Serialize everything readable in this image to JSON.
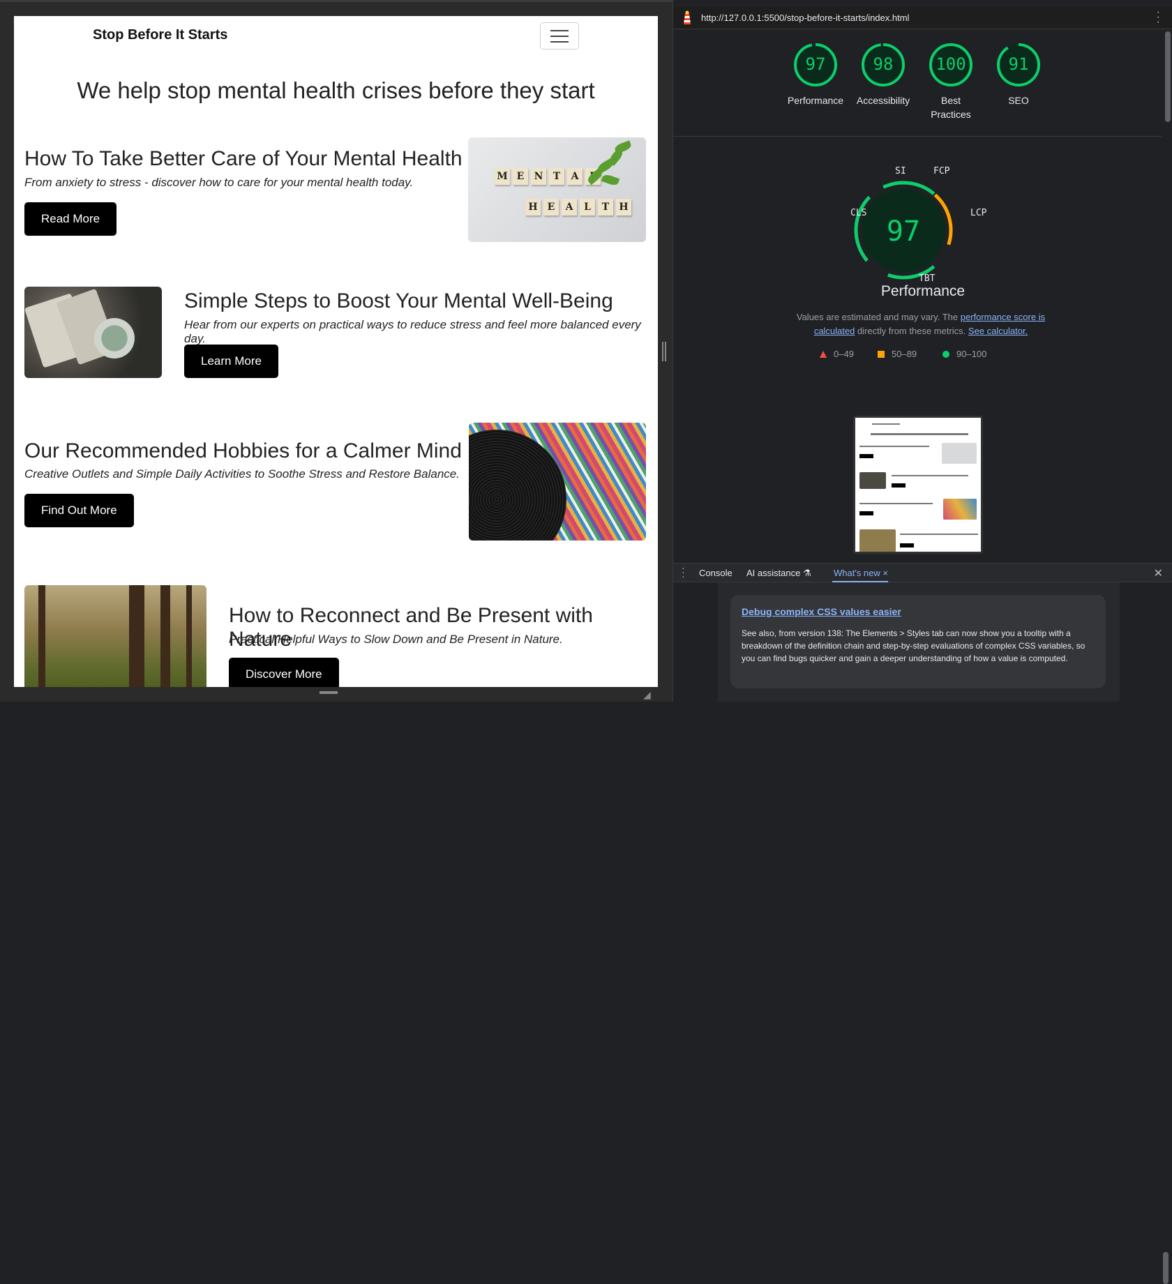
{
  "site": {
    "brand": "Stop Before It Starts",
    "hero_title": "We help stop mental health crises before they start",
    "cards": [
      {
        "title": "How To Take Better Care of Your Mental Health",
        "subtitle": "From anxiety to stress - discover how to care for your mental health today.",
        "button": "Read More",
        "image": "mental-health-tiles-image"
      },
      {
        "title": "Simple Steps to Boost Your Mental Well-Being",
        "subtitle": "Hear from our experts on practical ways to reduce stress and feel more balanced every day.",
        "button": "Learn More",
        "image": "book-and-tea-image"
      },
      {
        "title": "Our Recommended Hobbies for a Calmer Mind",
        "subtitle": "Creative Outlets and Simple Daily Activities to Soothe Stress and Restore Balance.",
        "button": "Find Out More",
        "image": "vinyl-records-image"
      },
      {
        "title": "How to Reconnect and Be Present with Nature",
        "subtitle": "Practical Helpful Ways to Slow Down and Be Present in Nature.",
        "button": "Discover More",
        "image": "forest-image"
      }
    ],
    "tile_words": [
      "MENTAL",
      "HEALTH"
    ]
  },
  "lighthouse": {
    "url": "http://127.0.0.1:5500/stop-before-it-starts/index.html",
    "gauges": [
      {
        "score": "97",
        "label": "Performance"
      },
      {
        "score": "98",
        "label": "Accessibility"
      },
      {
        "score": "100",
        "label": "Best Practices"
      },
      {
        "score": "91",
        "label": "SEO"
      }
    ],
    "big_score": "97",
    "metrics": {
      "si": "SI",
      "fcp": "FCP",
      "lcp": "LCP",
      "tbt": "TBT",
      "cls": "CLS"
    },
    "big_title": "Performance",
    "note_prefix": "Values are estimated and may vary. The ",
    "note_link1": "performance score is calculated",
    "note_middle": " directly from these metrics. ",
    "note_link2": "See calculator.",
    "legend": [
      "0–49",
      "50–89",
      "90–100"
    ],
    "colors": {
      "pass": "#0cce6b",
      "average": "#ffa400",
      "fail": "#ff4e42"
    }
  },
  "drawer": {
    "tabs": [
      "Console",
      "AI assistance",
      "What's new"
    ],
    "card_title": "Debug complex CSS values easier",
    "card_body": "See also, from version 138: The Elements > Styles tab can now show you a tooltip with a breakdown of the definition chain and step-by-step evaluations of complex CSS variables, so you can find bugs quicker and gain a deeper understanding of how a value is computed."
  }
}
